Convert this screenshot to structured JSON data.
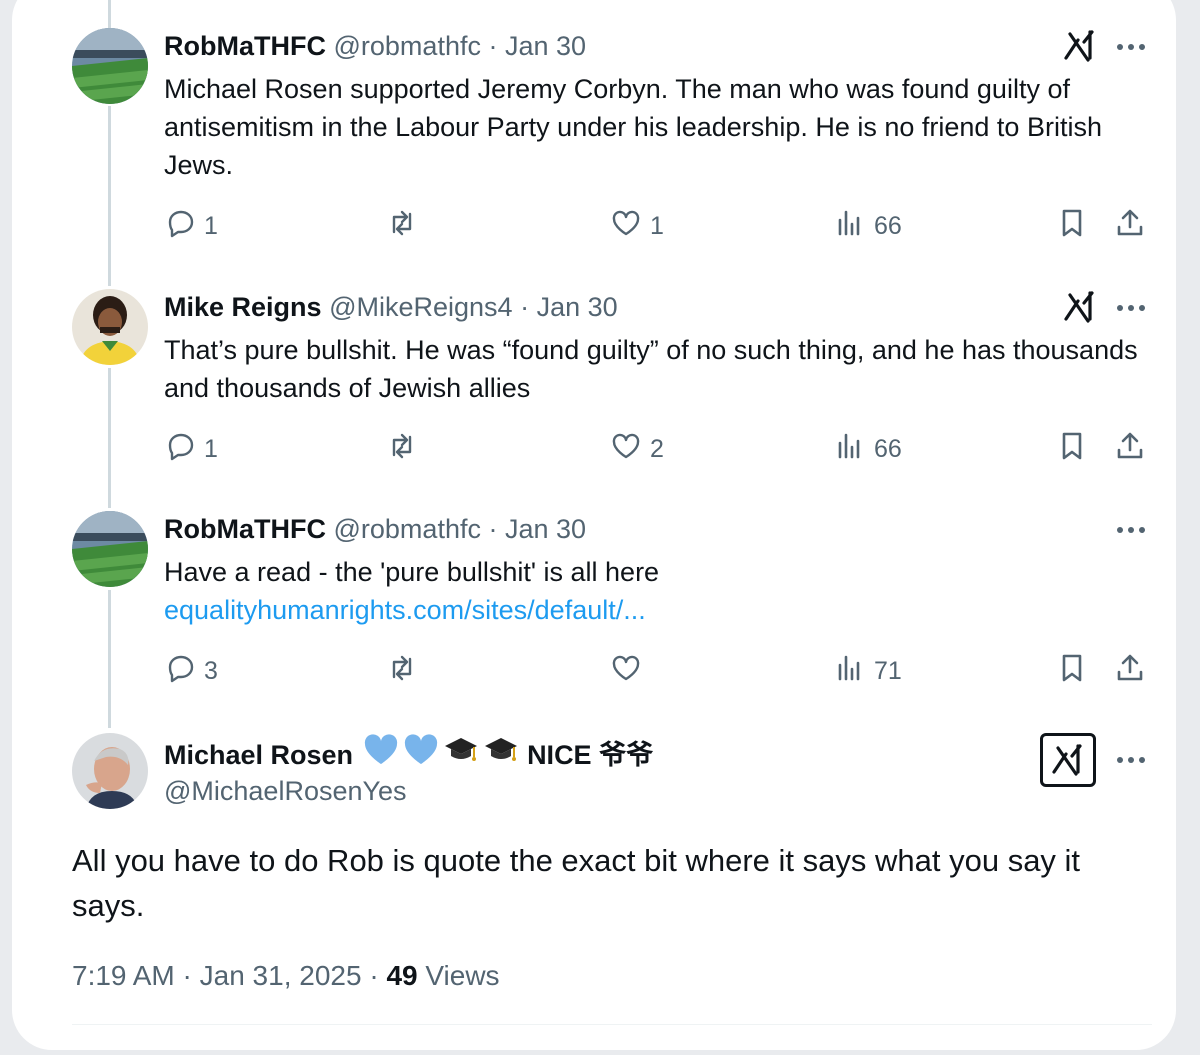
{
  "tweets": [
    {
      "name": "RobMaTHFC",
      "handle": "@robmathfc",
      "separator": "·",
      "date": "Jan 30",
      "text": "Michael Rosen supported Jeremy Corbyn. The man who was found guilty of antisemitism in the Labour Party under his leadership. He is no friend to British Jews.",
      "link": "",
      "replies": "1",
      "reposts": "",
      "likes": "1",
      "views": "66",
      "avatar_icon": "football-stadium-avatar"
    },
    {
      "name": "Mike Reigns",
      "handle": "@MikeReigns4",
      "separator": "·",
      "date": "Jan 30",
      "text": "That’s pure bullshit. He was “found guilty” of no such thing, and he has thousands and thousands of Jewish allies",
      "link": "",
      "replies": "1",
      "reposts": "",
      "likes": "2",
      "views": "66",
      "avatar_icon": "footballer-portrait-avatar"
    },
    {
      "name": "RobMaTHFC",
      "handle": "@robmathfc",
      "separator": "·",
      "date": "Jan 30",
      "text": "Have a read - the 'pure bullshit' is all here",
      "link": "equalityhumanrights.com/sites/default/...",
      "replies": "3",
      "reposts": "",
      "likes": "",
      "views": "71",
      "avatar_icon": "football-stadium-avatar"
    }
  ],
  "main_tweet": {
    "name": "Michael Rosen",
    "name_suffix": "NICE 爷爷",
    "handle": "@MichaelRosenYes",
    "text": "All  you have to do Rob is quote the exact bit where it says what you say it says.",
    "time": "7:19 AM",
    "separator": "·",
    "date": "Jan 31, 2025",
    "views_count": "49",
    "views_label": "Views",
    "avatar_icon": "elderly-man-portrait-avatar"
  },
  "colors": {
    "text": "#0f1419",
    "secondary": "#536471",
    "link": "#1d9bf0",
    "heart": "#78b4eb",
    "thread_line": "#cfd9de"
  },
  "icons": [
    "reply-icon",
    "repost-icon",
    "like-icon",
    "views-icon",
    "bookmark-icon",
    "share-icon",
    "grok-icon",
    "more-icon",
    "blue-heart-icon",
    "graduation-cap-icon"
  ]
}
